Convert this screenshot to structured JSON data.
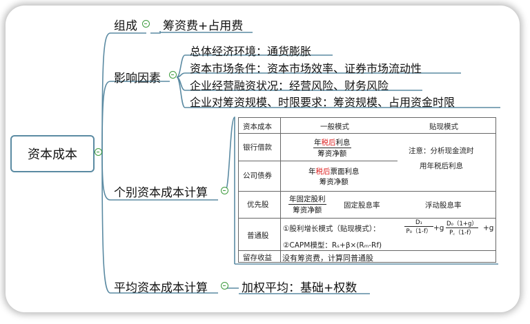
{
  "root": "资本成本",
  "branches": {
    "composition": {
      "label": "组成",
      "content": "筹资费+占用费"
    },
    "factors": {
      "label": "影响因素",
      "items": [
        "总体经济环境：通货膨胀",
        "资本市场条件：资本市场效率、证券市场流动性",
        "企业经营融资状况：经营风险、财务风险",
        "企业对筹资规模、时限要求：筹资规模、占用资金时限"
      ]
    },
    "individual": {
      "label": "个别资本成本计算",
      "table": {
        "row_capital": {
          "head": "资本成本",
          "col1": "一般模式",
          "col2": "贴现模式"
        },
        "row_loan": {
          "head": "银行借款",
          "num_a": "年",
          "num_red": "税后",
          "num_b": "利息",
          "den": "筹资净额"
        },
        "note": [
          "注意：分析现金流时",
          "用年税后利息"
        ],
        "row_bond": {
          "head": "公司债券",
          "num_a": "年",
          "num_red": "税后",
          "num_b": "票面利息",
          "den": "筹资净额"
        },
        "row_pref": {
          "head": "优先股",
          "num": "年固定股利",
          "den": "筹资净额",
          "fixed": "固定股息率",
          "float": "浮动股息率"
        },
        "row_common": {
          "head": "普通股",
          "m1": "①股利增长模式（贴现模式）：",
          "f1_num": "D₁",
          "f1_den": "P₀（1-f）",
          "plus_g1": "+g",
          "f2_num": "D₀（1+g）",
          "f2_den": "P꜀（1-f）",
          "plus_g2": "+g",
          "m2": "②CAPM模型：Rₛ+β×(Rₘ-Rf)"
        },
        "row_retained": {
          "head": "留存收益",
          "text": "没有筹资费，计算同普通股"
        }
      }
    },
    "average": {
      "label": "平均资本成本计算",
      "content": "加权平均：基础+权数"
    }
  },
  "colors": {
    "line": "#5a8aa2",
    "collapse": "#3c9a3c",
    "red": "#dd2222"
  }
}
